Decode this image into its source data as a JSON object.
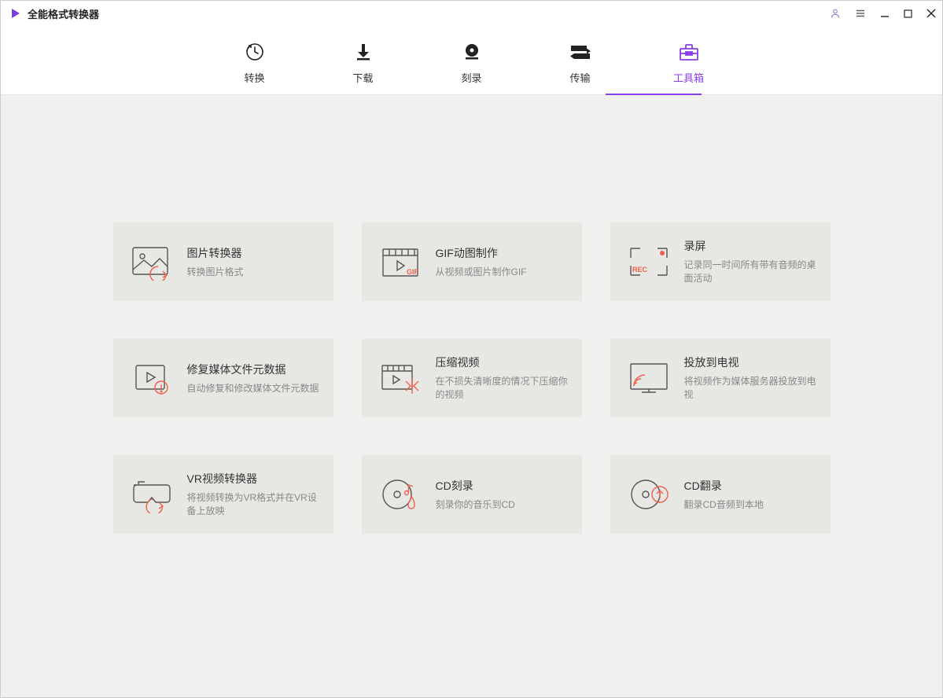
{
  "app": {
    "title": "全能格式转换器"
  },
  "nav": {
    "items": [
      {
        "label": "转换"
      },
      {
        "label": "下载"
      },
      {
        "label": "刻录"
      },
      {
        "label": "传输"
      },
      {
        "label": "工具箱"
      }
    ],
    "active_index": 4
  },
  "tools": [
    {
      "title": "图片转换器",
      "desc": "转换图片格式",
      "icon": "image-converter"
    },
    {
      "title": "GIF动图制作",
      "desc": "从视频或图片制作GIF",
      "icon": "gif-maker"
    },
    {
      "title": "录屏",
      "desc": "记录同一时间所有带有音频的桌面活动",
      "icon": "screen-recorder"
    },
    {
      "title": "修复媒体文件元数据",
      "desc": "自动修复和修改媒体文件元数据",
      "icon": "fix-metadata"
    },
    {
      "title": "压缩视频",
      "desc": "在不损失清晰度的情况下压缩你的视频",
      "icon": "compress-video"
    },
    {
      "title": "投放到电视",
      "desc": "将视频作为媒体服务器投放到电视",
      "icon": "cast-tv"
    },
    {
      "title": "VR视频转换器",
      "desc": "将视频转换为VR格式并在VR设备上放映",
      "icon": "vr-converter"
    },
    {
      "title": "CD刻录",
      "desc": "刻录你的音乐到CD",
      "icon": "cd-burn"
    },
    {
      "title": "CD翻录",
      "desc": "翻录CD音频到本地",
      "icon": "cd-rip"
    }
  ]
}
